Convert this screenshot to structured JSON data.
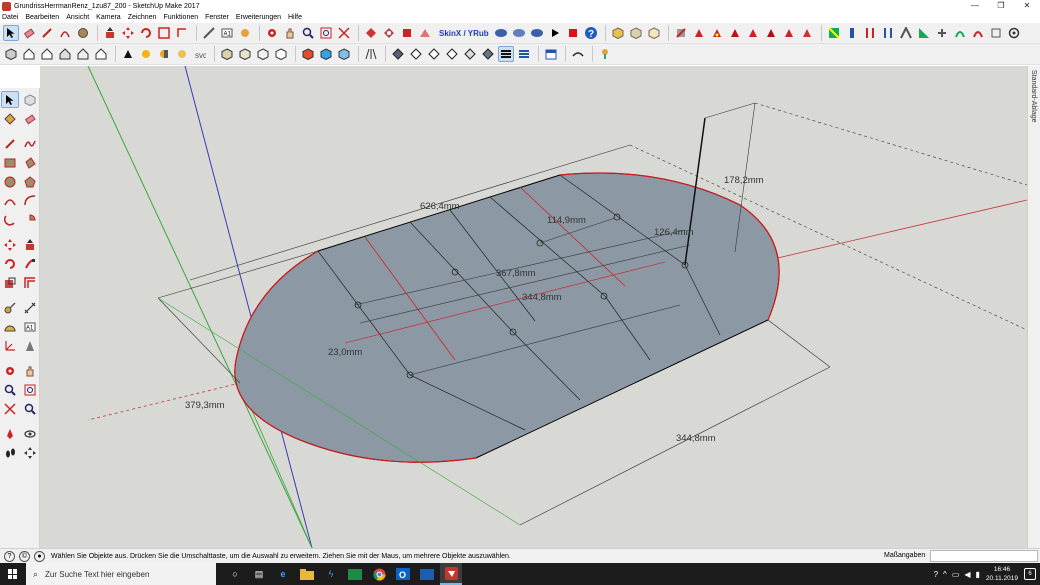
{
  "window": {
    "title": "GrundrissHerrmanRenz_1zu87_200 - SketchUp Make 2017",
    "minimize_glyph": "—",
    "maximize_glyph": "❐",
    "close_glyph": "✕"
  },
  "menu": [
    "Datei",
    "Bearbeiten",
    "Ansicht",
    "Kamera",
    "Zeichnen",
    "Funktionen",
    "Fenster",
    "Erweiterungen",
    "Hilfe"
  ],
  "toolbar": {
    "skin_label": "SkinX / YRub",
    "row1_icons": [
      "select-arrow",
      "eraser",
      "pencil-line",
      "arc",
      "paint-bucket",
      "push-pull",
      "move",
      "rotate",
      "scale",
      "tape-measure",
      "text",
      "paint",
      "orbit",
      "pan",
      "zoom",
      "zoom-extents",
      "section"
    ],
    "row2_icons": [
      "iso",
      "top",
      "front",
      "right",
      "back",
      "left",
      "xray",
      "wireframe",
      "hidden-line",
      "shaded",
      "textured",
      "monochrome"
    ]
  },
  "tray": {
    "label": "Standard-Ablage"
  },
  "drawing": {
    "dimensions": {
      "top_length": "626,4mm",
      "height": "178,2mm",
      "inner_a": "114,9mm",
      "inner_b": "126,4mm",
      "inner_c": "367,8mm",
      "inner_d": "344,8mm",
      "small": "23,0mm",
      "left_width": "379,3mm",
      "bottom_length": "344,8mm"
    },
    "colors": {
      "background": "#d8d8d5",
      "face": "#8c99a4",
      "edge": "#000000",
      "red_edge": "#d41818",
      "dim_line": "#333333",
      "axis_blue": "#3b3bb8",
      "axis_green": "#3aa83a",
      "axis_red": "#c03838"
    }
  },
  "status": {
    "hint": "Wählen Sie Objekte aus. Drücken Sie die Umschalttaste, um die Auswahl zu erweitern. Ziehen Sie mit der Maus, um mehrere Objekte auszuwählen.",
    "measurements_label": "Maßangaben",
    "measurements_value": ""
  },
  "taskbar": {
    "search_placeholder": "Zur Suche Text hier eingeben",
    "time": "16:46",
    "date": "20.11.2019",
    "notification_count": "6"
  }
}
